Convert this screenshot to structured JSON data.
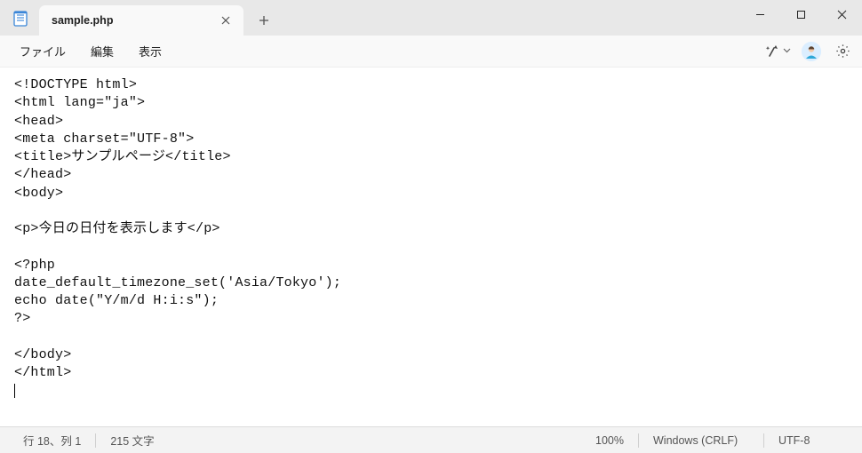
{
  "tab": {
    "filename": "sample.php"
  },
  "menu": {
    "file": "ファイル",
    "edit": "編集",
    "view": "表示"
  },
  "editor": {
    "content": "<!DOCTYPE html>\n<html lang=\"ja\">\n<head>\n<meta charset=\"UTF-8\">\n<title>サンプルページ</title>\n</head>\n<body>\n\n<p>今日の日付を表示します</p>\n\n<?php\ndate_default_timezone_set('Asia/Tokyo');\necho date(\"Y/m/d H:i:s\");\n?>\n\n</body>\n</html>"
  },
  "status": {
    "cursor": "行 18、列 1",
    "chars": "215 文字",
    "zoom": "100%",
    "line_ending": "Windows (CRLF)",
    "encoding": "UTF-8"
  }
}
